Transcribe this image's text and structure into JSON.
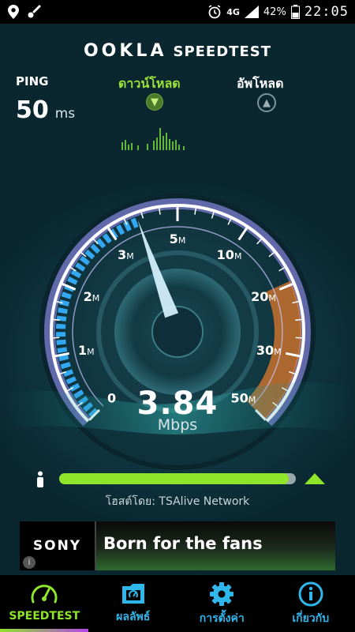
{
  "status_bar": {
    "network": "4G",
    "battery": "42%",
    "time": "22:05"
  },
  "logo": {
    "brand": "OOKLA",
    "product": "SPEEDTEST"
  },
  "ping": {
    "label": "PING",
    "value": "50",
    "unit": "ms"
  },
  "download": {
    "label": "ดาวน์โหลด",
    "icon": "download-arrow-icon"
  },
  "upload": {
    "label": "อัพโหลด",
    "icon": "upload-arrow-icon"
  },
  "gauge": {
    "ticks": [
      "0",
      "1M",
      "2M",
      "3M",
      "5M",
      "10M",
      "20M",
      "30M",
      "50M"
    ],
    "needle_value_mbps": 3.84,
    "colors": {
      "ring": "#9a8ff5",
      "progress": "#33a8f0",
      "high": "#e07a2a",
      "needle": "#d7f3ff"
    }
  },
  "result": {
    "speed": "3.84",
    "unit": "Mbps"
  },
  "progress": {
    "fill_fraction": 0.97,
    "fill_color": "#8ee52a",
    "track_color": "#9aa8ab"
  },
  "host": {
    "text": "โฮสต์โดย: TSAlive Network"
  },
  "ad": {
    "brand": "SONY",
    "headline": "Born for the fans",
    "info_glyph": "i"
  },
  "nav": {
    "items": [
      {
        "label": "SPEEDTEST",
        "icon": "speedometer-icon"
      },
      {
        "label": "ผลลัพธ์",
        "icon": "results-folder-icon"
      },
      {
        "label": "การตั้งค่า",
        "icon": "gear-icon"
      },
      {
        "label": "เกี่ยวกับ",
        "icon": "info-icon"
      }
    ]
  }
}
